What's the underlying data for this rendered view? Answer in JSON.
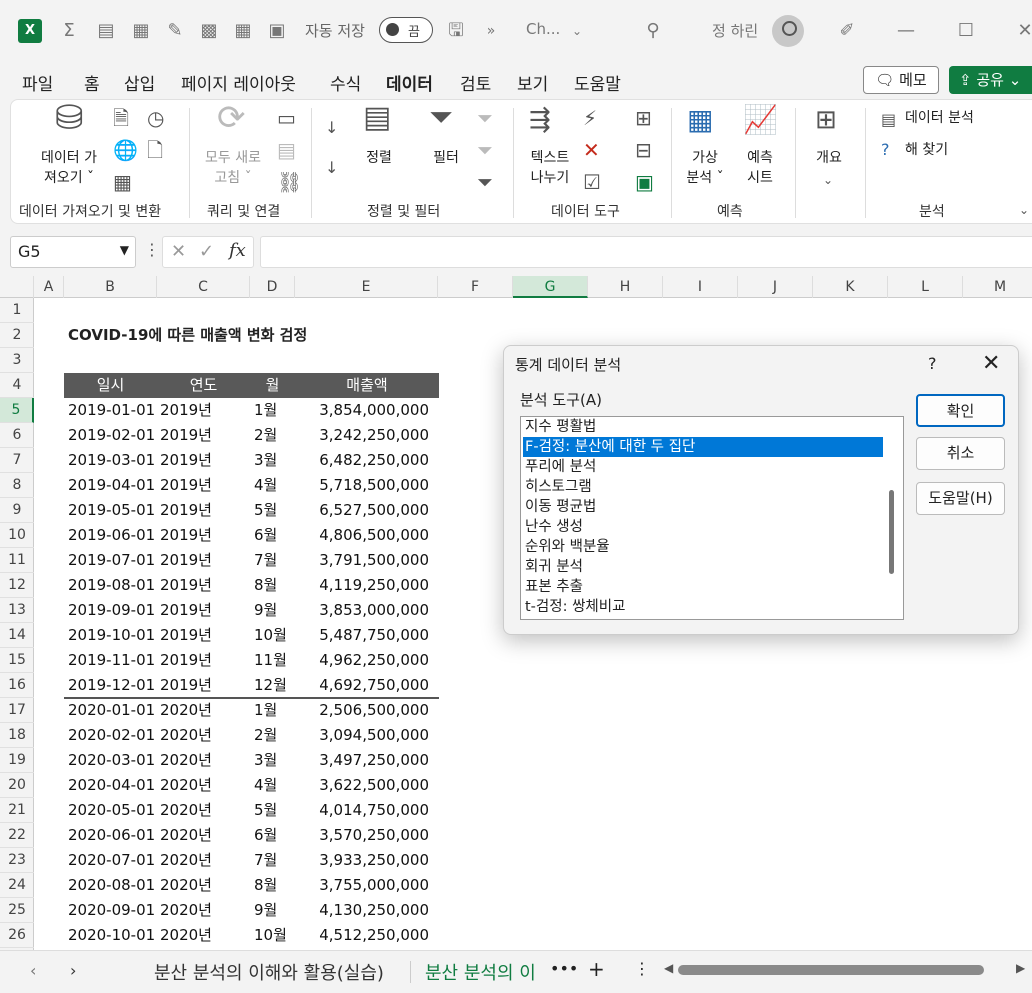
{
  "titlebar": {
    "autosave_label": "자동 저장",
    "autosave_state": "끔",
    "doc_title": "Ch...",
    "user_name": "정 하린"
  },
  "ribbon_tabs": [
    "파일",
    "홈",
    "삽입",
    "페이지 레이아웃",
    "수식",
    "데이터",
    "검토",
    "보기",
    "도움말"
  ],
  "active_tab": "데이터",
  "memo_label": "메모",
  "share_label": "공유",
  "ribbon": {
    "get_data": "데이터 가\n져오기 ˇ",
    "refresh_all": "모두 새로\n고침 ˇ",
    "sort": "정렬",
    "filter": "필터",
    "text_to_columns": "텍스트\n나누기",
    "what_if": "가상\n분석 ˇ",
    "forecast_sheet": "예측\n시트",
    "outline": "개요",
    "data_analysis": "데이터 분석",
    "solver": "해 찾기",
    "groups": {
      "get_transform": "데이터 가져오기 및 변환",
      "queries": "쿼리 및 연결",
      "sort_filter": "정렬 및 필터",
      "data_tools": "데이터 도구",
      "forecast": "예측",
      "analysis": "분석"
    }
  },
  "name_box": "G5",
  "columns": [
    "A",
    "B",
    "C",
    "D",
    "E",
    "F",
    "G",
    "H",
    "I",
    "J",
    "K",
    "L",
    "M"
  ],
  "selected_column": "G",
  "rows": [
    "1",
    "2",
    "3",
    "4",
    "5",
    "6",
    "7",
    "8",
    "9",
    "10",
    "11",
    "12",
    "13",
    "14",
    "15",
    "16",
    "17",
    "18",
    "19",
    "20",
    "21",
    "22",
    "23",
    "24",
    "25",
    "26"
  ],
  "selected_row": "5",
  "sheet_title": "COVID-19에 따른 매출액 변화 검정",
  "table_headers": [
    "일시",
    "연도",
    "월",
    "매출액"
  ],
  "table_rows": [
    [
      "2019-01-01",
      "2019년",
      "1월",
      "3,854,000,000"
    ],
    [
      "2019-02-01",
      "2019년",
      "2월",
      "3,242,250,000"
    ],
    [
      "2019-03-01",
      "2019년",
      "3월",
      "6,482,250,000"
    ],
    [
      "2019-04-01",
      "2019년",
      "4월",
      "5,718,500,000"
    ],
    [
      "2019-05-01",
      "2019년",
      "5월",
      "6,527,500,000"
    ],
    [
      "2019-06-01",
      "2019년",
      "6월",
      "4,806,500,000"
    ],
    [
      "2019-07-01",
      "2019년",
      "7월",
      "3,791,500,000"
    ],
    [
      "2019-08-01",
      "2019년",
      "8월",
      "4,119,250,000"
    ],
    [
      "2019-09-01",
      "2019년",
      "9월",
      "3,853,000,000"
    ],
    [
      "2019-10-01",
      "2019년",
      "10월",
      "5,487,750,000"
    ],
    [
      "2019-11-01",
      "2019년",
      "11월",
      "4,962,250,000"
    ],
    [
      "2019-12-01",
      "2019년",
      "12월",
      "4,692,750,000"
    ],
    [
      "2020-01-01",
      "2020년",
      "1월",
      "2,506,500,000"
    ],
    [
      "2020-02-01",
      "2020년",
      "2월",
      "3,094,500,000"
    ],
    [
      "2020-03-01",
      "2020년",
      "3월",
      "3,497,250,000"
    ],
    [
      "2020-04-01",
      "2020년",
      "4월",
      "3,622,500,000"
    ],
    [
      "2020-05-01",
      "2020년",
      "5월",
      "4,014,750,000"
    ],
    [
      "2020-06-01",
      "2020년",
      "6월",
      "3,570,250,000"
    ],
    [
      "2020-07-01",
      "2020년",
      "7월",
      "3,933,250,000"
    ],
    [
      "2020-08-01",
      "2020년",
      "8월",
      "3,755,000,000"
    ],
    [
      "2020-09-01",
      "2020년",
      "9월",
      "4,130,250,000"
    ],
    [
      "2020-10-01",
      "2020년",
      "10월",
      "4,512,250,000"
    ]
  ],
  "sheet_tabs": [
    "분산 분석의 이해와 활용(실습)",
    "분산 분석의 이"
  ],
  "dialog": {
    "title": "통계 데이터 분석",
    "help": "?",
    "tool_label": "분석 도구(A)",
    "tools": [
      "지수 평활법",
      "F-검정: 분산에 대한 두 집단",
      "푸리에 분석",
      "히스토그램",
      "이동 평균법",
      "난수 생성",
      "순위와 백분율",
      "회귀 분석",
      "표본 추출",
      "t-검정: 쌍체비교"
    ],
    "selected_tool": "F-검정: 분산에 대한 두 집단",
    "ok": "확인",
    "cancel": "취소",
    "help_btn": "도움말(H)"
  }
}
